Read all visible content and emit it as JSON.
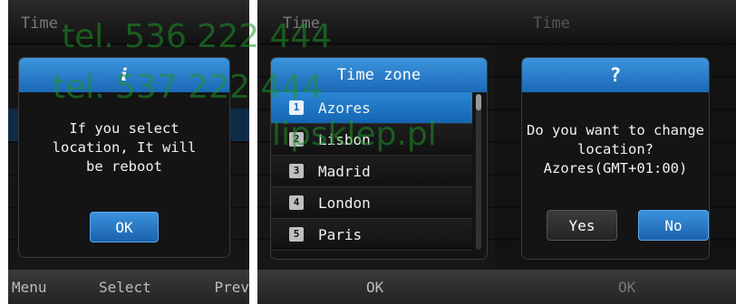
{
  "screen1": {
    "title": "Time",
    "dialog": {
      "icon": "i",
      "message_lines": [
        "If you select",
        "location, It will",
        "be reboot"
      ],
      "ok": "OK"
    },
    "softkeys": {
      "left": "Menu",
      "center": "Select",
      "right": "Prev"
    }
  },
  "screen2": {
    "title": "Time",
    "dialog": {
      "header": "Time zone",
      "items": [
        {
          "num": "1",
          "label": "Azores",
          "selected": true
        },
        {
          "num": "2",
          "label": "Lisbon",
          "selected": false
        },
        {
          "num": "3",
          "label": "Madrid",
          "selected": false
        },
        {
          "num": "4",
          "label": "London",
          "selected": false
        },
        {
          "num": "5",
          "label": "Paris",
          "selected": false
        }
      ]
    },
    "softkeys": {
      "center": "OK"
    }
  },
  "screen3": {
    "title": "Time",
    "dialog": {
      "icon": "?",
      "message_lines": [
        "Do you want to change",
        "location?",
        "Azores(GMT+01:00)"
      ],
      "yes": "Yes",
      "no": "No"
    },
    "softkeys": {
      "center": "OK"
    }
  },
  "watermarks": [
    "tel. 536 222 444",
    "tel. 537 222 444",
    "lipsklep.pl"
  ],
  "colors": {
    "accent_blue": "#1c68b6",
    "watermark_green": "#1e9628"
  }
}
